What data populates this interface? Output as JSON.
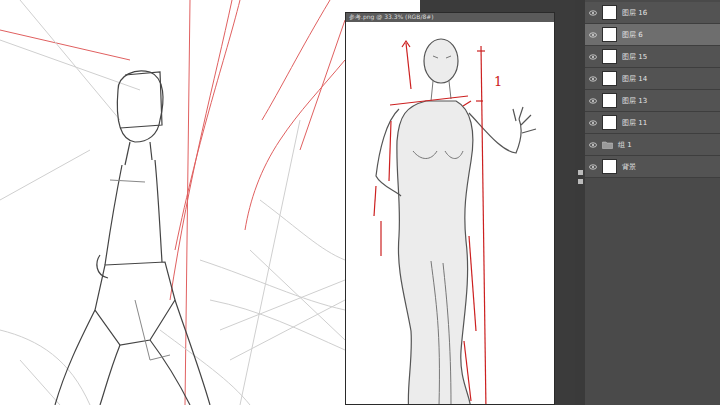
{
  "window": {
    "title": "参考.png @ 33.3% (RGB/8#)"
  },
  "reference": {
    "annotation": "1"
  },
  "layers": [
    {
      "name": "图层 16",
      "visible": true,
      "selected": false,
      "kind": "layer"
    },
    {
      "name": "图层 6",
      "visible": true,
      "selected": true,
      "kind": "layer"
    },
    {
      "name": "图层 15",
      "visible": true,
      "selected": false,
      "kind": "layer"
    },
    {
      "name": "图层 14",
      "visible": true,
      "selected": false,
      "kind": "layer"
    },
    {
      "name": "图层 13",
      "visible": true,
      "selected": false,
      "kind": "layer"
    },
    {
      "name": "图层 11",
      "visible": true,
      "selected": false,
      "kind": "layer"
    },
    {
      "name": "组 1",
      "visible": true,
      "selected": false,
      "kind": "group"
    },
    {
      "name": "背景",
      "visible": true,
      "selected": false,
      "kind": "layer"
    }
  ]
}
